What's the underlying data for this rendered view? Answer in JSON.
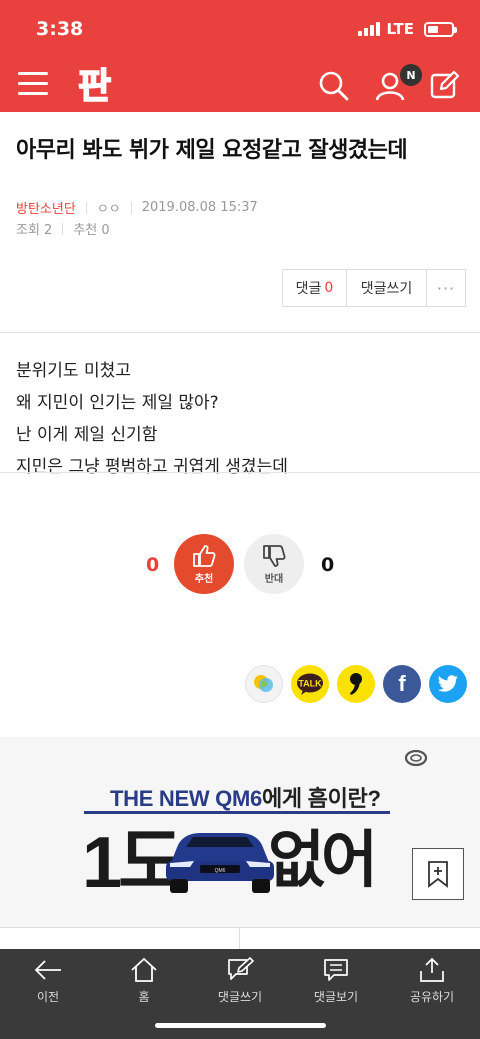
{
  "status": {
    "time": "3:38",
    "network": "LTE"
  },
  "header": {
    "logo": "판",
    "notification_badge": "N",
    "accent_color": "#e8413e"
  },
  "post": {
    "title": "아무리 봐도 뷔가 제일 요정같고 잘생겼는데",
    "author": "방탄소년단",
    "nickname": "ㅇㅇ",
    "datetime": "2019.08.08 15:37",
    "views": "조회 2",
    "recommend": "추천 0",
    "body": [
      "분위기도 미쳤고",
      "왜 지민이 인기는 제일 많아?",
      "난 이게 제일 신기함",
      "지민은 그냥 평범하고 귀엽게 생겼는데"
    ]
  },
  "actions": {
    "comment_label": "댓글",
    "comment_count": "0",
    "write_comment": "댓글쓰기",
    "more": "···"
  },
  "vote": {
    "up_count": "0",
    "up_label": "추천",
    "down_label": "반대",
    "down_count": "0"
  },
  "share": {
    "talk_label": "TALK",
    "facebook": "f"
  },
  "ad": {
    "headline_en": "THE NEW QM6",
    "headline_ko": "에게 흠이란?",
    "big_left": "1도",
    "big_right": "없어",
    "car_badge": "QM6"
  },
  "bottom_nav": [
    {
      "label": "이전",
      "icon": "back-arrow-icon"
    },
    {
      "label": "홈",
      "icon": "home-icon"
    },
    {
      "label": "댓글쓰기",
      "icon": "write-comment-icon"
    },
    {
      "label": "댓글보기",
      "icon": "view-comment-icon"
    },
    {
      "label": "공유하기",
      "icon": "share-icon"
    }
  ]
}
